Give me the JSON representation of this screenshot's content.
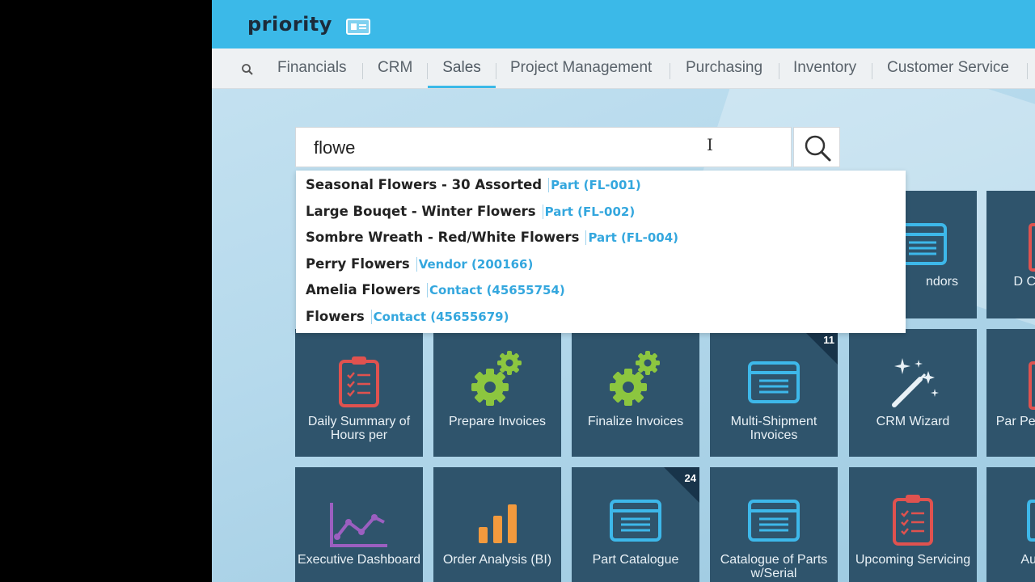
{
  "header": {
    "logo": "priority"
  },
  "menu": {
    "items": [
      "Financials",
      "CRM",
      "Sales",
      "Project Management",
      "Purchasing",
      "Inventory",
      "Customer Service"
    ],
    "active": "Sales"
  },
  "search": {
    "value": "flowe"
  },
  "suggestions": [
    {
      "name": "Seasonal Flowers - 30 Assorted",
      "tag": "Part (FL-001)"
    },
    {
      "name": "Large Bouqet - Winter Flowers",
      "tag": "Part (FL-002)"
    },
    {
      "name": "Sombre Wreath - Red/White Flowers",
      "tag": "Part (FL-004)"
    },
    {
      "name": "Perry Flowers",
      "tag": "Vendor (200166)"
    },
    {
      "name": "Amelia Flowers",
      "tag": "Contact (45655754)"
    },
    {
      "name": "Flowers",
      "tag": "Contact (45655679)"
    }
  ],
  "tiles": {
    "row1": {
      "vendors": {
        "label": "ndors",
        "icon": "form-icon"
      },
      "d_cu": {
        "label": "D Cu",
        "icon": "report-icon"
      }
    },
    "row2": [
      {
        "label": "Daily Summary of Hours per",
        "icon": "clipboard-icon"
      },
      {
        "label": "Prepare Invoices",
        "icon": "gears-icon"
      },
      {
        "label": "Finalize Invoices",
        "icon": "gears-icon"
      },
      {
        "label": "Multi-Shipment Invoices",
        "icon": "form-icon",
        "badge": "11"
      },
      {
        "label": "CRM Wizard",
        "icon": "magic-wand-icon"
      },
      {
        "label": "Par Per",
        "icon": "report-icon"
      }
    ],
    "row3": [
      {
        "label": "Executive Dashboard",
        "icon": "line-chart-icon"
      },
      {
        "label": "Order Analysis (BI)",
        "icon": "bar-chart-icon"
      },
      {
        "label": "Part Catalogue",
        "icon": "form-icon",
        "badge": "24"
      },
      {
        "label": "Catalogue of Parts w/Serial",
        "icon": "form-icon"
      },
      {
        "label": "Upcoming Servicing",
        "icon": "clipboard-icon"
      },
      {
        "label": "Au",
        "icon": "form-icon"
      }
    ]
  },
  "colors": {
    "topbar": "#3bb9e8",
    "tile": "#2f546c",
    "accent": "#3bb9e8",
    "link": "#34a7de",
    "gear": "#8cc63f",
    "clipboard": "#e0524f",
    "chart_line": "#9b5fc0",
    "bar_chart": "#f39a3d"
  }
}
